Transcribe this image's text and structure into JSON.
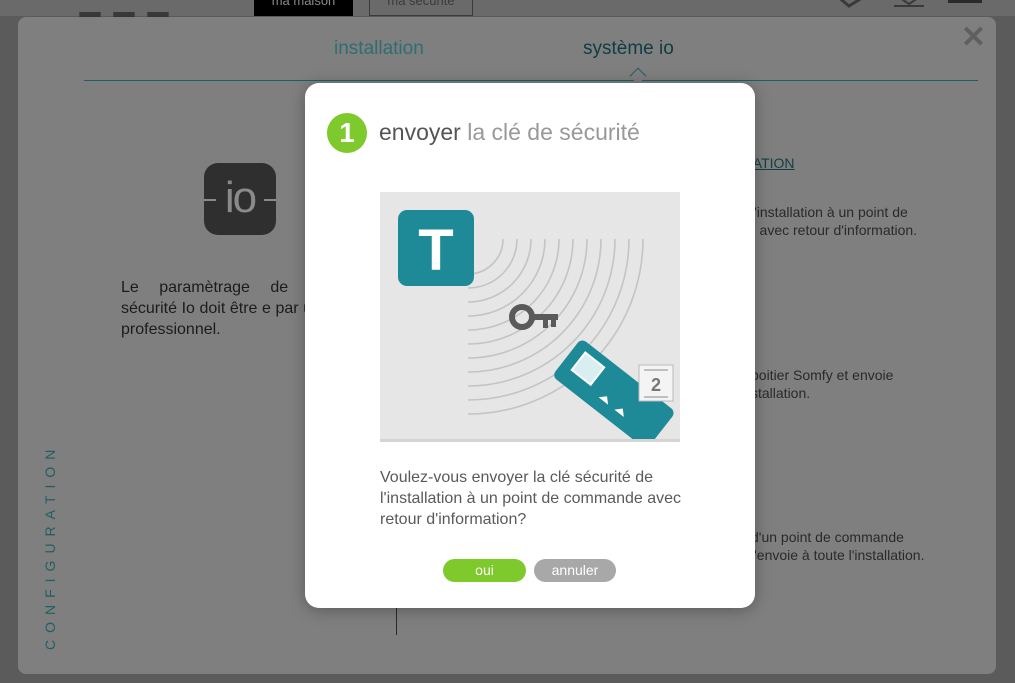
{
  "header": {
    "logo_text": "",
    "tabs": [
      "ma maison",
      "ma sécurité"
    ]
  },
  "panel": {
    "tabs": [
      {
        "label": "installation",
        "active": false
      },
      {
        "label": "système io",
        "active": true
      }
    ],
    "io_logo": "io",
    "intro_text": "Le paramètrage de la sécurité Io doit être e par un professionnel.",
    "vertical_label": "CONFIGURATION",
    "link_label": "LATION",
    "right_texts": [
      "l'installation à un point de\n) avec retour d'information.",
      " boitier Somfy et envoie\nstallation.",
      "d'un point de commande\nl'envoie à toute l'installation."
    ]
  },
  "modal": {
    "step_number": "1",
    "title_part1": "envoyer",
    "title_part2": "la clé de sécurité",
    "illustration": {
      "box_letter": "T",
      "remote_badge": "2"
    },
    "question": "Voulez-vous envoyer la clé sécurité de l'installation à un point de commande avec retour d'information?",
    "buttons": {
      "confirm": "oui",
      "cancel": "annuler"
    }
  },
  "colors": {
    "accent_green": "#7ec92c",
    "teal": "#1e8a97",
    "overlay_panel": "#7f7f7f"
  }
}
